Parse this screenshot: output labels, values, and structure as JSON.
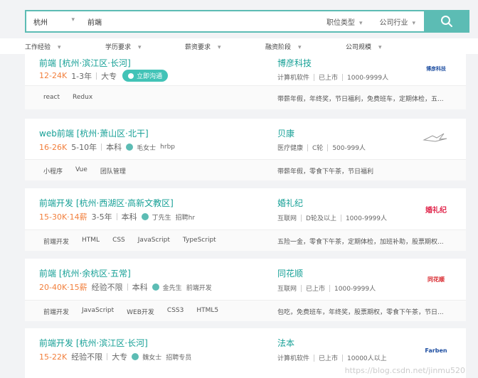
{
  "search": {
    "city": "杭州",
    "keyword": "前端",
    "dropdown_position": "职位类型",
    "dropdown_industry": "公司行业"
  },
  "filters": [
    "工作经验",
    "学历要求",
    "薪资要求",
    "融资阶段",
    "公司规模"
  ],
  "jobs": [
    {
      "title": "前端  [杭州·滨江区·长河]",
      "salary": "12-24K",
      "experience": "1-3年",
      "education": "大专",
      "chat_label": "立即沟通",
      "hr_name": "",
      "hr_role": "",
      "company": "博彦科技",
      "industry": "计算机软件",
      "stage": "已上市",
      "size": "1000-9999人",
      "logo": "博彦科技",
      "tags": [
        "react",
        "Redux"
      ],
      "benefits": "带薪年假，年终奖，节日福利，免费班车，定期体检，五..."
    },
    {
      "title": "web前端  [杭州·萧山区·北干]",
      "salary": "16-26K",
      "experience": "5-10年",
      "education": "本科",
      "chat_label": "",
      "hr_name": "毛女士",
      "hr_role": "hrbp",
      "company": "贝康",
      "industry": "医疗健康",
      "stage": "C轮",
      "size": "500-999人",
      "logo": "",
      "tags": [
        "小程序",
        "Vue",
        "团队管理"
      ],
      "benefits": "带薪年假，零食下午茶，节日福利"
    },
    {
      "title": "前端开发  [杭州·西湖区·高新文教区]",
      "salary": "15-30K·14薪",
      "experience": "3-5年",
      "education": "本科",
      "chat_label": "",
      "hr_name": "丁先生",
      "hr_role": "招聘hr",
      "company": "婚礼纪",
      "industry": "互联网",
      "stage": "D轮及以上",
      "size": "1000-9999人",
      "logo": "婚礼纪",
      "tags": [
        "前端开发",
        "HTML",
        "CSS",
        "JavaScript",
        "TypeScript"
      ],
      "benefits": "五险一金，零食下午茶，定期体检，加班补助，股票期权..."
    },
    {
      "title": "前端  [杭州·余杭区·五常]",
      "salary": "20-40K·15薪",
      "experience": "经验不限",
      "education": "本科",
      "chat_label": "",
      "hr_name": "金先生",
      "hr_role": "前端开发",
      "company": "同花顺",
      "industry": "互联网",
      "stage": "已上市",
      "size": "1000-9999人",
      "logo": "同花顺",
      "tags": [
        "前端开发",
        "JavaScript",
        "WEB开发",
        "CSS3",
        "HTML5"
      ],
      "benefits": "包吃，免费班车，年终奖，股票期权，零食下午茶，节日..."
    },
    {
      "title": "前端开发  [杭州·滨江区·长河]",
      "salary": "15-22K",
      "experience": "经验不限",
      "education": "大专",
      "chat_label": "",
      "hr_name": "魏女士",
      "hr_role": "招聘专员",
      "company": "法本",
      "industry": "计算机软件",
      "stage": "已上市",
      "size": "10000人以上",
      "logo": "Farben",
      "tags": [],
      "benefits": ""
    }
  ],
  "watermark": "https://blog.csdn.net/jinmu520",
  "colors": {
    "accent": "#5cbcb4",
    "salary": "#f27f3c",
    "link": "#16a096"
  }
}
